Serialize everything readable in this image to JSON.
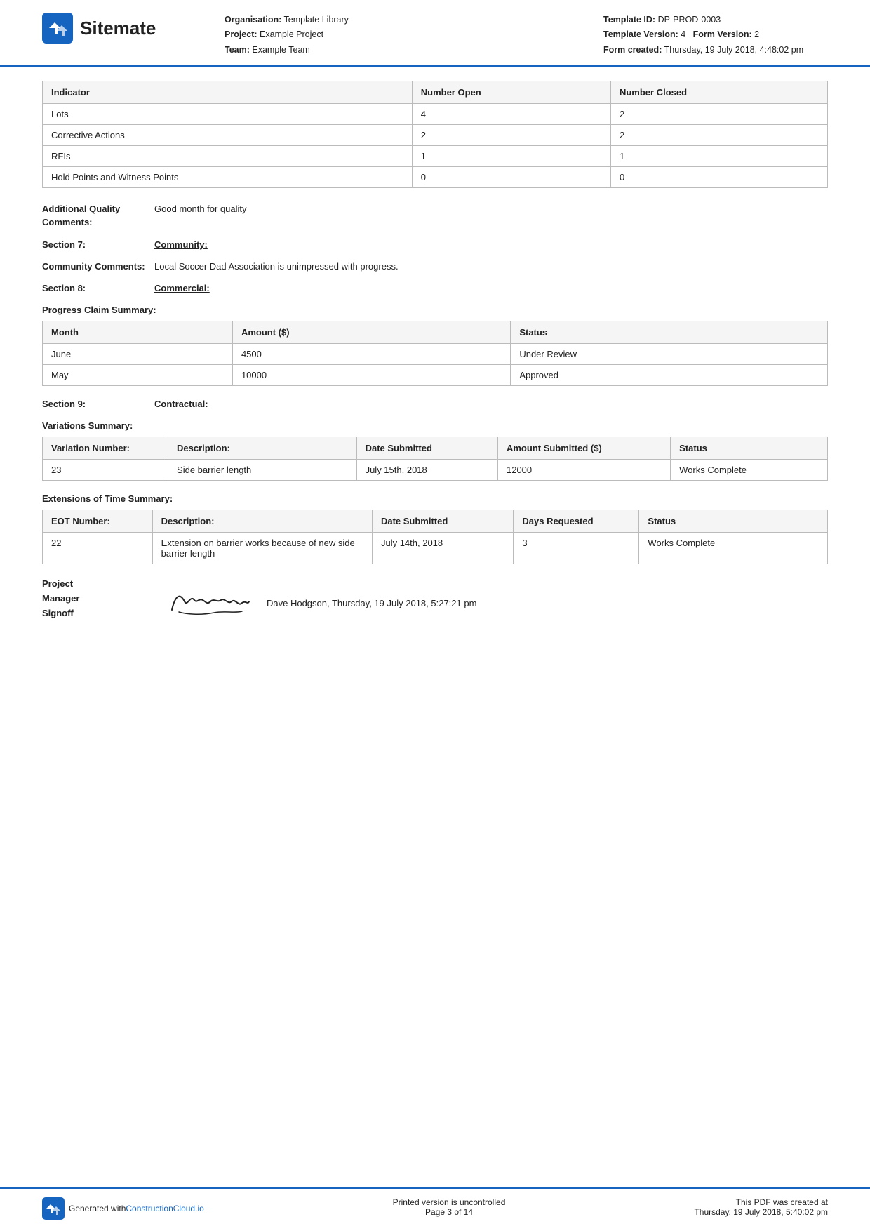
{
  "header": {
    "logo_text": "Sitemate",
    "org_label": "Organisation:",
    "org_value": "Template Library",
    "project_label": "Project:",
    "project_value": "Example Project",
    "team_label": "Team:",
    "team_value": "Example Team",
    "template_id_label": "Template ID:",
    "template_id_value": "DP-PROD-0003",
    "template_version_label": "Template Version:",
    "template_version_value": "4",
    "form_version_label": "Form Version:",
    "form_version_value": "2",
    "form_created_label": "Form created:",
    "form_created_value": "Thursday, 19 July 2018, 4:48:02 pm"
  },
  "indicator_table": {
    "col1": "Indicator",
    "col2": "Number Open",
    "col3": "Number Closed",
    "rows": [
      {
        "indicator": "Lots",
        "open": "4",
        "closed": "2"
      },
      {
        "indicator": "Corrective Actions",
        "open": "2",
        "closed": "2"
      },
      {
        "indicator": "RFIs",
        "open": "1",
        "closed": "1"
      },
      {
        "indicator": "Hold Points and Witness Points",
        "open": "0",
        "closed": "0"
      }
    ]
  },
  "additional_quality": {
    "label": "Additional Quality Comments:",
    "value": "Good month for quality"
  },
  "section7": {
    "number": "Section 7:",
    "title": "Community:"
  },
  "community_comments": {
    "label": "Community Comments:",
    "value": "Local Soccer Dad Association is unimpressed with progress."
  },
  "section8": {
    "number": "Section 8:",
    "title": "Commercial:"
  },
  "progress_claim": {
    "heading": "Progress Claim Summary:",
    "col1": "Month",
    "col2": "Amount ($)",
    "col3": "Status",
    "rows": [
      {
        "month": "June",
        "amount": "4500",
        "status": "Under Review"
      },
      {
        "month": "May",
        "amount": "10000",
        "status": "Approved"
      }
    ]
  },
  "section9": {
    "number": "Section 9:",
    "title": "Contractual:"
  },
  "variations": {
    "heading": "Variations Summary:",
    "col1": "Variation Number:",
    "col2": "Description:",
    "col3": "Date Submitted",
    "col4": "Amount Submitted ($)",
    "col5": "Status",
    "rows": [
      {
        "number": "23",
        "description": "Side barrier length",
        "date": "July 15th, 2018",
        "amount": "12000",
        "status": "Works Complete"
      }
    ]
  },
  "eot": {
    "heading": "Extensions of Time Summary:",
    "col1": "EOT Number:",
    "col2": "Description:",
    "col3": "Date Submitted",
    "col4": "Days Requested",
    "col5": "Status",
    "rows": [
      {
        "number": "22",
        "description": "Extension on barrier works because of new side barrier length",
        "date": "July 14th, 2018",
        "days": "3",
        "status": "Works Complete"
      }
    ]
  },
  "signature": {
    "label_line1": "Project",
    "label_line2": "Manager",
    "label_line3": "Signoff",
    "detail": "Dave Hodgson, Thursday, 19 July 2018, 5:27:21 pm"
  },
  "footer": {
    "generated_text": "Generated with ",
    "link_text": "ConstructionCloud.io",
    "uncontrolled": "Printed version is uncontrolled",
    "page": "Page 3 of 14",
    "pdf_created_label": "This PDF was created at",
    "pdf_created_value": "Thursday, 19 July 2018, 5:40:02 pm"
  }
}
